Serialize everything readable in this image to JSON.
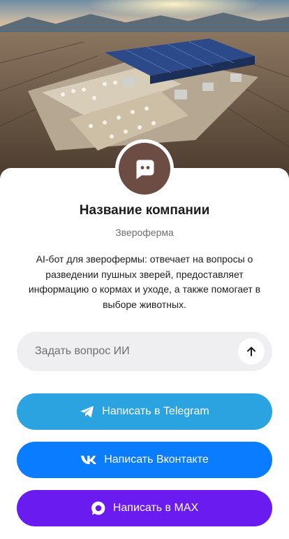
{
  "company": {
    "name": "Название компании",
    "category": "Звероферма",
    "description": "AI-бот для зверофермы: отвечает на вопросы о разведении пушных зверей, предоставляет информацию о кормах и уходе, а также помогает в выборе животных."
  },
  "ask": {
    "placeholder": "Задать вопрос ИИ",
    "value": ""
  },
  "buttons": [
    {
      "label": "Написать в Telegram",
      "icon": "telegram-icon",
      "color": "#2aa3e0"
    },
    {
      "label": "Написать Вконтакте",
      "icon": "vk-icon",
      "color": "#0a7cff"
    },
    {
      "label": "Написать в MAX",
      "icon": "max-icon",
      "color": "#6a1cf0"
    }
  ],
  "colors": {
    "avatar_bg": "#6d4c44",
    "input_bg": "#efeff1"
  }
}
